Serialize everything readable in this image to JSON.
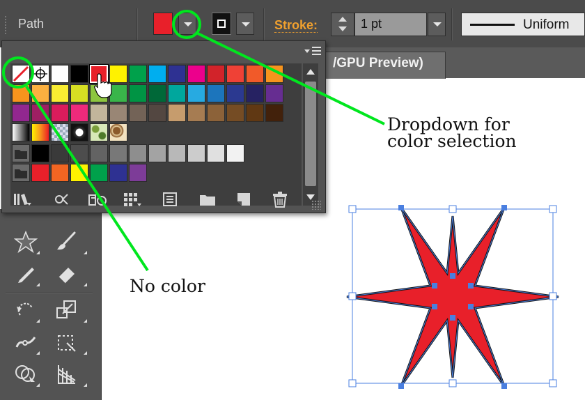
{
  "control_bar": {
    "object_type": "Path",
    "fill_color": "#e8202a",
    "stroke_label": "Stroke:",
    "stroke_weight": "1 pt",
    "profile": "Uniform"
  },
  "document_tab": {
    "title": "/GPU Preview)"
  },
  "swatches_panel": {
    "rows": [
      [
        "none",
        "registration",
        "#ffffff",
        "#000000",
        "#e8202a",
        "#fff200",
        "#00a14b",
        "#00aeef",
        "#2e3192",
        "#ec008c",
        "#d2232a",
        "#ef4136",
        "#f15a29",
        "#f7941d"
      ],
      [
        "#f7941d",
        "#fbb040",
        "#f9ed32",
        "#d7df23",
        "#8dc63f",
        "#39b54a",
        "#009444",
        "#006838",
        "#00a79d",
        "#27aae1",
        "#1c75bc",
        "#2b3990",
        "#262262",
        "#662d91"
      ],
      [
        "#92278f",
        "#9e1f63",
        "#da1c5c",
        "#ee2a7b",
        "#c2b59b",
        "#998675",
        "#736357",
        "#534741",
        "#c69c6d",
        "#a67c52",
        "#8c6239",
        "#754c24",
        "#603813",
        "#42210b"
      ],
      [
        "gradient-gray",
        "gradient-orange",
        "pattern-checker",
        "pattern-leopard",
        "pattern-leaves",
        "pattern-paisley"
      ],
      [
        "folder",
        "#000000",
        "#3a3a3a",
        "#4d4d4d",
        "#636363",
        "#787878",
        "#8e8e8e",
        "#a3a3a3",
        "#b8b8b8",
        "#cccccc",
        "#e0e0e0",
        "#f2f2f2"
      ],
      [
        "folder",
        "#e8202a",
        "#f26522",
        "#fff200",
        "#00a14b",
        "#2e3192",
        "#7d3c98"
      ]
    ]
  },
  "callouts": {
    "dropdown": [
      "Dropdown for",
      "color selection"
    ],
    "no_color": "No color"
  },
  "colors": {
    "annotation": "#00e61e",
    "selection": "#4a7fe0",
    "star_fill": "#e8202a"
  }
}
